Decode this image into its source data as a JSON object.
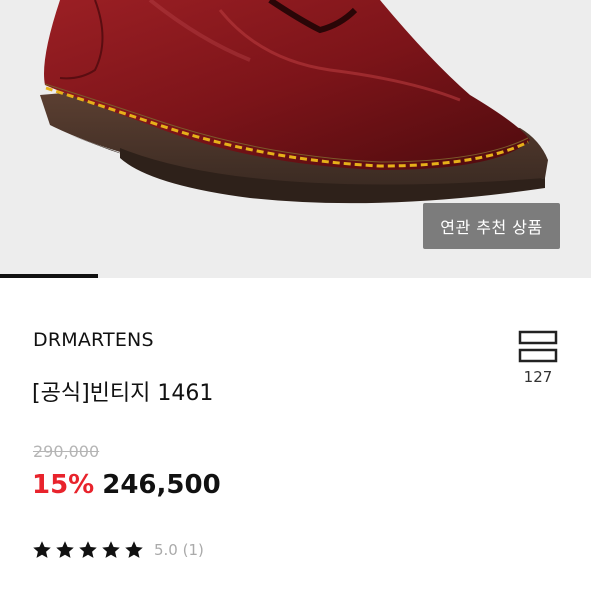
{
  "hero": {
    "image_alt": "Dr. Martens 1461 vintage oxblood shoe",
    "recommend_button": "연관 추천 상품",
    "carousel_progress": 0.166
  },
  "product": {
    "brand": "DRMARTENS",
    "name": "[공식]빈티지 1461",
    "original_price": "290,000",
    "discount": "15%",
    "sale_price": "246,500"
  },
  "save": {
    "icon": "bookmark-list-icon",
    "count": "127"
  },
  "rating": {
    "stars": 5,
    "text": "5.0 (1)"
  },
  "colors": {
    "accent_discount": "#e8232c",
    "hero_bg": "#ededed",
    "recommend_bg": "#7c7c7c"
  }
}
